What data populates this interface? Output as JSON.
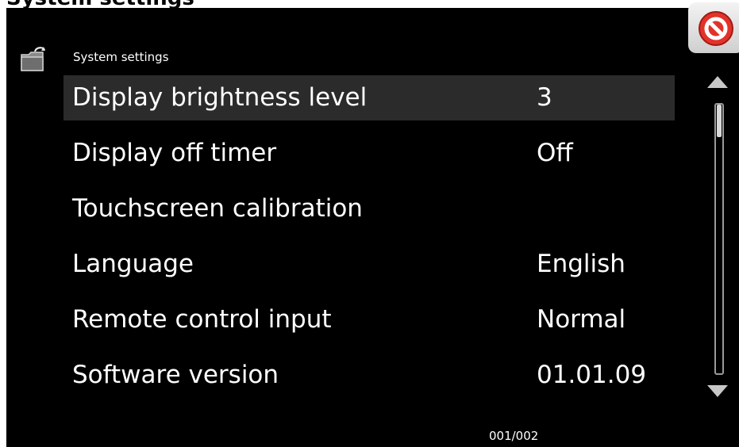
{
  "window": {
    "caption": "System settings"
  },
  "screen": {
    "title": "System settings",
    "title_icon": "folder-back-icon"
  },
  "settings": [
    {
      "label": "Display brightness level",
      "value": "3",
      "selected": true
    },
    {
      "label": "Display off timer",
      "value": "Off",
      "selected": false
    },
    {
      "label": "Touchscreen calibration",
      "value": "",
      "selected": false
    },
    {
      "label": "Language",
      "value": "English",
      "selected": false
    },
    {
      "label": "Remote control input",
      "value": "Normal",
      "selected": false
    },
    {
      "label": "Software version",
      "value": "01.01.09",
      "selected": false
    }
  ],
  "scrollbar": {
    "up_icon": "triangle-up-icon",
    "down_icon": "triangle-down-icon",
    "position": 0.0,
    "visible_fraction": 0.12
  },
  "pagination": {
    "text": "001/002"
  },
  "close_button": {
    "icon": "no-entry-icon"
  },
  "colors": {
    "background": "#000000",
    "selected_row": "#2b2b2b",
    "text": "#ffffff",
    "close_red": "#e2332a"
  }
}
